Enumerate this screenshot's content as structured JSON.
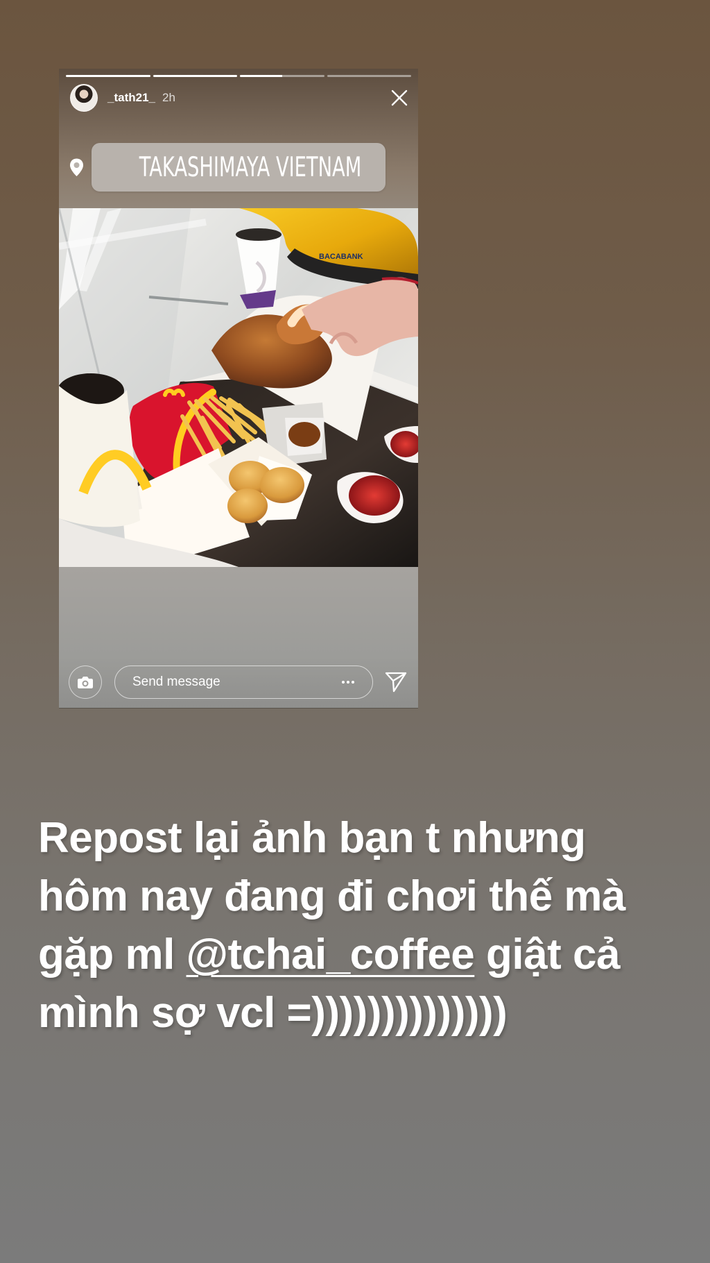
{
  "story": {
    "progress": [
      1,
      1,
      0.5,
      0
    ],
    "username": "_tath21_",
    "time_ago": "2h",
    "location": "TAKASHIMAYA VIETNAM",
    "message_placeholder": "Send message"
  },
  "caption": {
    "line_1": "Repost lại ảnh bạn t nhưng",
    "line_2": "hôm nay đang đi chơi thế mà",
    "line_3_before": "gặp ml ",
    "line_3_mention": "@tchai_coffee",
    "line_3_after": " giật cả",
    "line_4": "mình sợ vcl =))))))))))))))"
  },
  "colors": {
    "background_top": "#6b553f",
    "background_bottom": "#7b7b7b",
    "text": "#ffffff"
  },
  "icons": {
    "close": "close-icon",
    "location": "map-pin-icon",
    "camera": "camera-icon",
    "more": "more-options-icon",
    "send": "send-icon"
  }
}
